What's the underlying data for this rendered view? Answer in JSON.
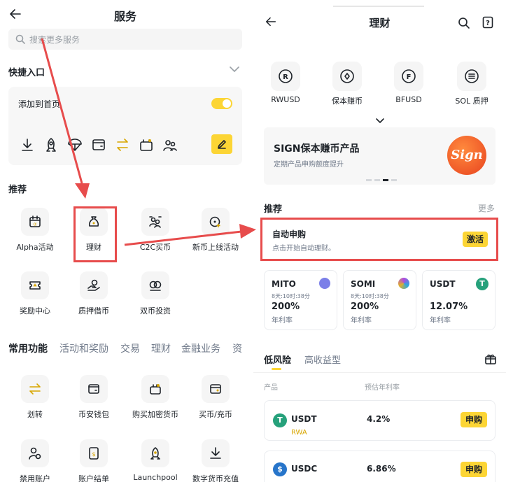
{
  "left": {
    "title": "服务",
    "search_placeholder": "搜索更多服务",
    "quick_title": "快捷入口",
    "add_home_label": "添加到首页",
    "rec_title": "推荐",
    "rec_items": [
      {
        "label": "Alpha活动",
        "icon": "alpha-icon"
      },
      {
        "label": "理财",
        "icon": "moneybag-icon"
      },
      {
        "label": "C2C买币",
        "icon": "c2c-icon"
      },
      {
        "label": "新币上线活动",
        "icon": "new-coin-icon"
      },
      {
        "label": "奖励中心",
        "icon": "ticket-icon"
      },
      {
        "label": "质押借币",
        "icon": "loan-icon"
      },
      {
        "label": "双币投资",
        "icon": "dual-coin-icon"
      }
    ],
    "tabs": [
      "常用功能",
      "活动和奖励",
      "交易",
      "理财",
      "金融业务",
      "资"
    ],
    "common_items": [
      {
        "label": "划转",
        "icon": "transfer-icon"
      },
      {
        "label": "币安钱包",
        "icon": "wallet-icon"
      },
      {
        "label": "购买加密货币",
        "icon": "buy-crypto-icon"
      },
      {
        "label": "买币/充币",
        "icon": "card-icon"
      },
      {
        "label": "禁用账户",
        "icon": "user-block-icon"
      },
      {
        "label": "账户结单",
        "icon": "statement-icon"
      },
      {
        "label": "Launchpool",
        "icon": "rocket-icon"
      },
      {
        "label": "数字货币充值",
        "icon": "deposit-icon"
      }
    ]
  },
  "right": {
    "title": "理财",
    "coins": [
      {
        "label": "RWUSD",
        "glyph": "R"
      },
      {
        "label": "保本赚币",
        "glyph": "◈"
      },
      {
        "label": "BFUSD",
        "glyph": "F"
      },
      {
        "label": "SOL 质押",
        "glyph": "≡"
      }
    ],
    "banner": {
      "title": "SIGN保本赚币产品",
      "subtitle": "定期产品申购额度提升",
      "logo": "Sign"
    },
    "rec_title": "推荐",
    "more": "更多",
    "auto": {
      "title": "自动申购",
      "subtitle": "点击开始自动理财。",
      "button": "激活"
    },
    "products": [
      {
        "name": "MITO",
        "time": "8天:10时:38分",
        "rate": "200%",
        "rate_label": "年利率",
        "color": "#7b7fe8"
      },
      {
        "name": "SOMI",
        "time": "8天:10时:38分",
        "rate": "200%",
        "rate_label": "年利率",
        "color": "#b04ae0"
      },
      {
        "name": "USDT",
        "time": "",
        "rate": "12.07%",
        "rate_label": "年利率",
        "color": "#26a17b"
      }
    ],
    "risk_tabs": [
      "低风险",
      "高收益型"
    ],
    "col_product": "产品",
    "col_rate": "预估年利率",
    "list": [
      {
        "name": "USDT",
        "tag": "RWA",
        "rate": "4.2%",
        "button": "申购",
        "color": "#26a17b"
      },
      {
        "name": "USDC",
        "tag": "",
        "rate": "6.86%",
        "button": "申购",
        "color": "#2775ca"
      }
    ]
  },
  "colors": {
    "accent": "#fcd535",
    "annotation": "#e74c4c"
  }
}
